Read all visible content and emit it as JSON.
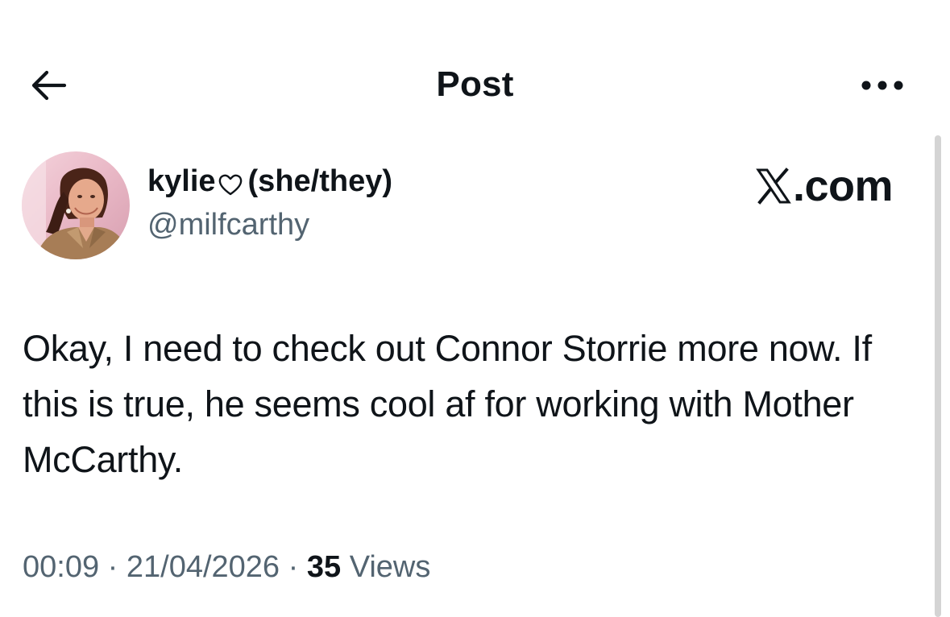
{
  "header": {
    "title": "Post",
    "back_icon": "arrow-left-icon",
    "more_icon": "more-horizontal-icon"
  },
  "post": {
    "display_name": "kylie",
    "pronouns": "(she/they)",
    "handle": "@milfcarthy",
    "brand": ".com",
    "text": "Okay, I need to check out Connor Storrie more now. If this is true, he seems cool af for working with Mother McCarthy.",
    "time": "00:09",
    "separator": "·",
    "date": "21/04/2026",
    "views_count": "35",
    "views_label": "Views"
  },
  "colors": {
    "text": "#0f1419",
    "secondary": "#536471",
    "scrollbar": "#d4d4d4"
  }
}
